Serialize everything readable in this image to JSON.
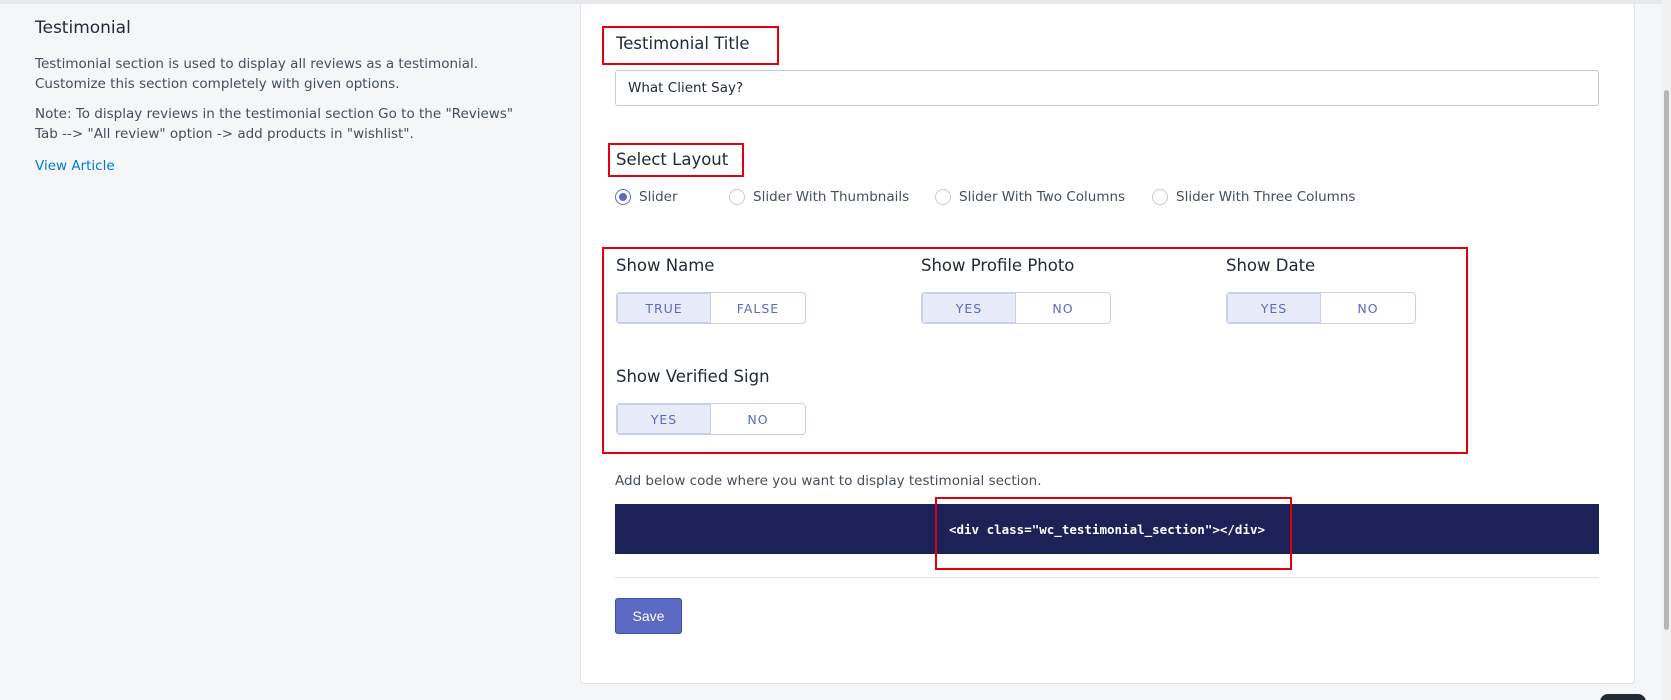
{
  "sidebar": {
    "title": "Testimonial",
    "description": "Testimonial section is used to display all reviews as a testimonial. Customize this section completely with given options.",
    "note": "Note: To display reviews in the testimonial section Go to the \"Reviews\" Tab --> \"All review\" option -> add products in \"wishlist\".",
    "link": "View Article"
  },
  "title_field": {
    "label": "Testimonial Title",
    "value": "What Client Say?"
  },
  "layout": {
    "label": "Select Layout",
    "options": [
      {
        "label": "Slider",
        "selected": true
      },
      {
        "label": "Slider With Thumbnails",
        "selected": false
      },
      {
        "label": "Slider With Two Columns",
        "selected": false
      },
      {
        "label": "Slider With Three Columns",
        "selected": false
      }
    ]
  },
  "toggles": {
    "show_name": {
      "label": "Show Name",
      "on": "TRUE",
      "off": "FALSE",
      "active": "on"
    },
    "show_profile_photo": {
      "label": "Show Profile Photo",
      "on": "YES",
      "off": "NO",
      "active": "on"
    },
    "show_date": {
      "label": "Show Date",
      "on": "YES",
      "off": "NO",
      "active": "on"
    },
    "show_verified_sign": {
      "label": "Show Verified Sign",
      "on": "YES",
      "off": "NO",
      "active": "on"
    }
  },
  "code": {
    "hint": "Add below code where you want to display testimonial section.",
    "snippet": "<div class=\"wc_testimonial_section\"></div>"
  },
  "actions": {
    "save_label": "Save"
  },
  "colors": {
    "accent": "#5c6ac4",
    "code_bg": "#1c2258",
    "highlight": "#e0000f",
    "link": "#007ace"
  }
}
